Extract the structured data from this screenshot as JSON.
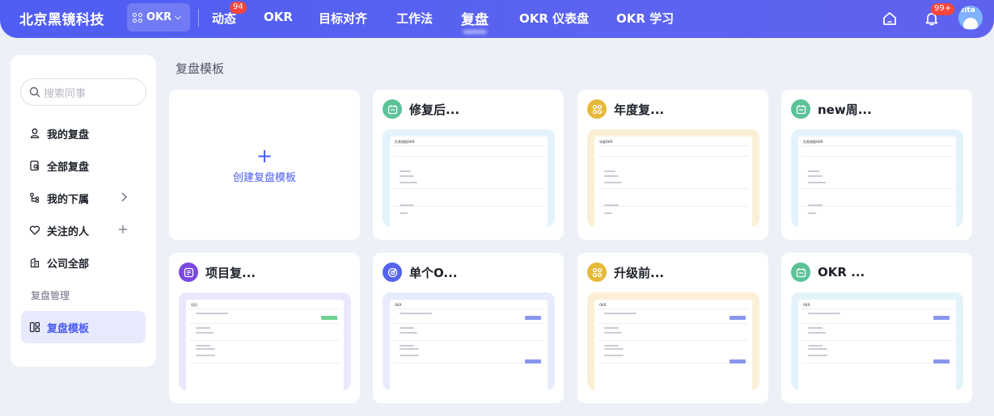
{
  "brand": "北京黑镜科技",
  "switcher": {
    "label": "OKR"
  },
  "nav": [
    {
      "label": "动态",
      "badge": "94"
    },
    {
      "label": "OKR"
    },
    {
      "label": "目标对齐"
    },
    {
      "label": "工作法"
    },
    {
      "label": "复盘",
      "active": true
    },
    {
      "label": "OKR 仪表盘"
    },
    {
      "label": "OKR 学习"
    }
  ],
  "notifications": {
    "badge": "99+"
  },
  "avatar": {
    "text": "tita"
  },
  "sidebar": {
    "search_placeholder": "搜索同事",
    "items": [
      {
        "label": "我的复盘"
      },
      {
        "label": "全部复盘"
      },
      {
        "label": "我的下属"
      },
      {
        "label": "关注的人"
      },
      {
        "label": "公司全部"
      }
    ],
    "section_label": "复盘管理",
    "template_item": {
      "label": "复盘模板",
      "active": true
    }
  },
  "main": {
    "title": "复盘模板",
    "create_label": "创建复盘模板",
    "cards": [
      {
        "title": "修复后...",
        "icon": "calendar-icon",
        "icon_color": "#5cc398",
        "preview_color": "#e4f3fb",
        "preview_title": "负责周报OKR"
      },
      {
        "title": "年度复...",
        "icon": "grid-icon",
        "icon_color": "#e6b93a",
        "preview_color": "#fbf0d6",
        "preview_title": "年度OKR"
      },
      {
        "title": "new周...",
        "icon": "calendar-icon",
        "icon_color": "#5cc398",
        "preview_color": "#e4f3fb",
        "preview_title": "负责周报OKR"
      },
      {
        "title": "项目复...",
        "icon": "list-icon",
        "icon_color": "#7a48e0",
        "preview_color": "#ece7fa",
        "preview_title": "项目"
      },
      {
        "title": "单个O...",
        "icon": "target-icon",
        "icon_color": "#5663ef",
        "preview_color": "#e7ebfb",
        "preview_title": "OKR"
      },
      {
        "title": "升级前...",
        "icon": "grid-icon",
        "icon_color": "#e6b93a",
        "preview_color": "#fbf0d6",
        "preview_title": "OKR"
      },
      {
        "title": "OKR ...",
        "icon": "calendar-icon",
        "icon_color": "#5cc398",
        "preview_color": "#e4f3fb",
        "preview_title": "OKR"
      }
    ]
  }
}
